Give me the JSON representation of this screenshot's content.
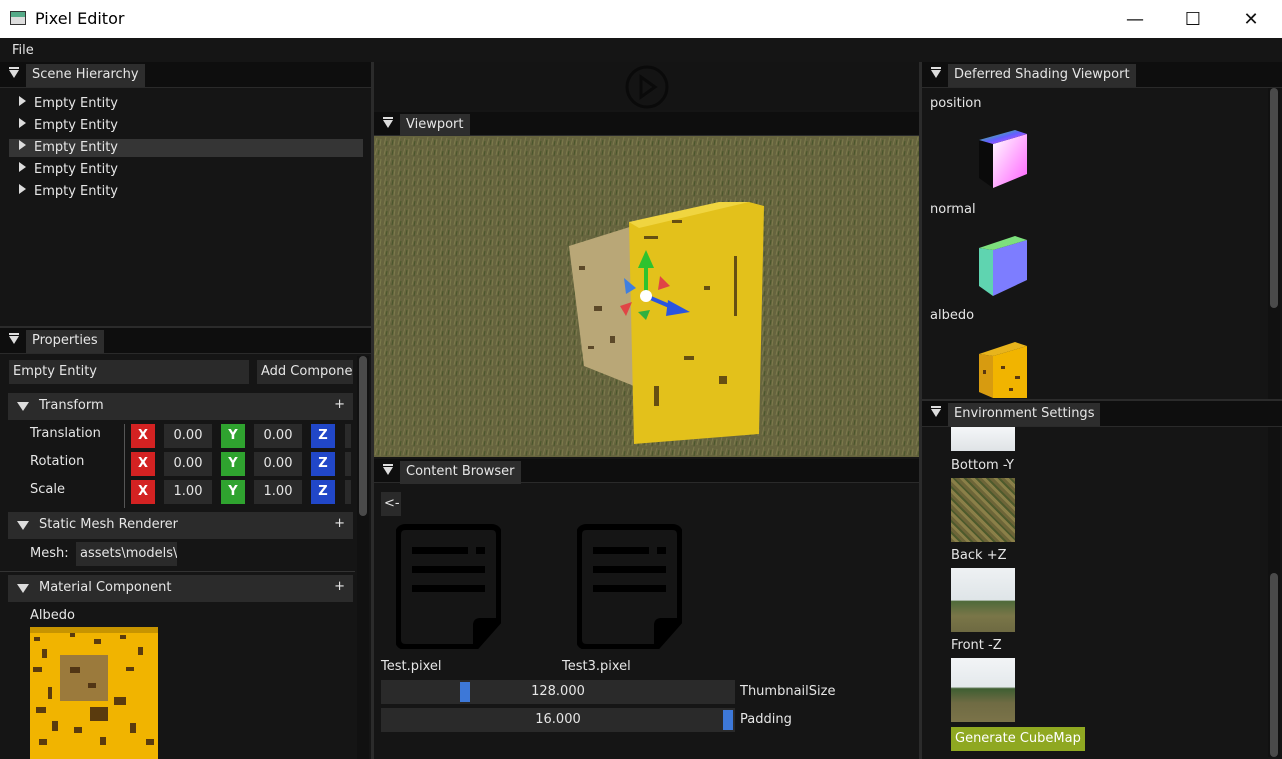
{
  "window": {
    "title": "Pixel Editor",
    "controls": {
      "minimize": "—",
      "maximize": "☐",
      "close": "✕"
    }
  },
  "menu": {
    "file": "File"
  },
  "hierarchy": {
    "tab": "Scene Hierarchy",
    "items": [
      {
        "label": "Empty Entity",
        "selected": false
      },
      {
        "label": "Empty Entity",
        "selected": false
      },
      {
        "label": "Empty Entity",
        "selected": true
      },
      {
        "label": "Empty Entity",
        "selected": false
      },
      {
        "label": "Empty Entity",
        "selected": false
      }
    ]
  },
  "properties": {
    "tab": "Properties",
    "entity_name": "Empty Entity",
    "add_component": "Add Component",
    "transform": {
      "header": "Transform",
      "plus": "+",
      "rows": [
        {
          "label": "Translation",
          "x": "0.00",
          "y": "0.00"
        },
        {
          "label": "Rotation",
          "x": "0.00",
          "y": "0.00"
        },
        {
          "label": "Scale",
          "x": "1.00",
          "y": "1.00"
        }
      ],
      "axes": {
        "x": "X",
        "y": "Y",
        "z": "Z"
      }
    },
    "mesh_renderer": {
      "header": "Static Mesh Renderer",
      "plus": "+",
      "mesh_label": "Mesh:",
      "mesh_value": "assets\\models\\"
    },
    "material": {
      "header": "Material Component",
      "plus": "+",
      "albedo_label": "Albedo"
    }
  },
  "toolbar": {
    "play_icon": "play-icon"
  },
  "viewport": {
    "tab": "Viewport"
  },
  "content_browser": {
    "tab": "Content Browser",
    "back": "<-",
    "files": [
      "Test.pixel",
      "Test3.pixel"
    ],
    "sliders": [
      {
        "label": "ThumbnailSize",
        "value": "128.000",
        "fraction": 0.22
      },
      {
        "label": "Padding",
        "value": "16.000",
        "fraction": 1.0
      }
    ]
  },
  "deferred": {
    "tab": "Deferred Shading Viewport",
    "buffers": [
      "position",
      "normal",
      "albedo"
    ]
  },
  "environment": {
    "tab": "Environment Settings",
    "faces": [
      "Bottom -Y",
      "Back +Z",
      "Front -Z"
    ],
    "generate_button": "Generate CubeMap"
  },
  "colors": {
    "accent": "#3d78d8",
    "generate_btn": "#8fa821",
    "axis_x": "#d32222",
    "axis_y": "#2fa32f",
    "axis_z": "#2147c8",
    "albedo_yellow": "#f1b400"
  }
}
